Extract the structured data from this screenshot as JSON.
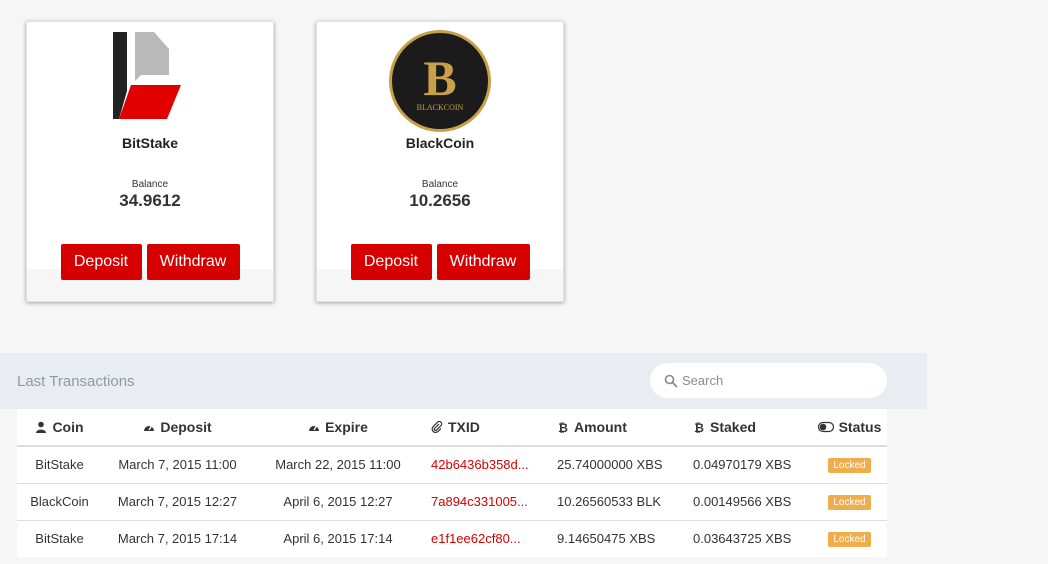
{
  "coins": [
    {
      "name": "BitStake",
      "logo_icon": "bitstake-logo",
      "balance_label": "Balance",
      "balance": "34.9612",
      "deposit_label": "Deposit",
      "withdraw_label": "Withdraw"
    },
    {
      "name": "BlackCoin",
      "logo_icon": "blackcoin-logo",
      "logo_text": "BLACKCOIN",
      "balance_label": "Balance",
      "balance": "10.2656",
      "deposit_label": "Deposit",
      "withdraw_label": "Withdraw"
    }
  ],
  "transactions": {
    "title": "Last Transactions",
    "search_placeholder": "Search",
    "columns": [
      {
        "label": "Coin",
        "icon": "user-icon"
      },
      {
        "label": "Deposit",
        "icon": "dashboard-icon"
      },
      {
        "label": "Expire",
        "icon": "dashboard-icon"
      },
      {
        "label": "TXID",
        "icon": "paperclip-icon"
      },
      {
        "label": "Amount",
        "icon": "bitcoin-icon"
      },
      {
        "label": "Staked",
        "icon": "bitcoin-icon"
      },
      {
        "label": "Status",
        "icon": "toggle-icon"
      }
    ],
    "rows": [
      {
        "coin": "BitStake",
        "deposit": "March 7, 2015 11:00",
        "expire": "March 22, 2015 11:00",
        "txid": "42b6436b358d...",
        "amount": "25.74000000 XBS",
        "staked": "0.04970179 XBS",
        "status": "Locked"
      },
      {
        "coin": "BlackCoin",
        "deposit": "March 7, 2015 12:27",
        "expire": "April 6, 2015 12:27",
        "txid": "7a894c331005...",
        "amount": "10.26560533 BLK",
        "staked": "0.00149566 XBS",
        "status": "Locked"
      },
      {
        "coin": "BitStake",
        "deposit": "March 7, 2015 17:14",
        "expire": "April 6, 2015 17:14",
        "txid": "e1f1ee62cf80...",
        "amount": "9.14650475 XBS",
        "staked": "0.03643725 XBS",
        "status": "Locked"
      }
    ]
  },
  "colors": {
    "accent_red": "#d60000",
    "locked_badge": "#f0ad4e",
    "header_band": "#e9edf2",
    "blackcoin_gold": "#c9a04a"
  }
}
